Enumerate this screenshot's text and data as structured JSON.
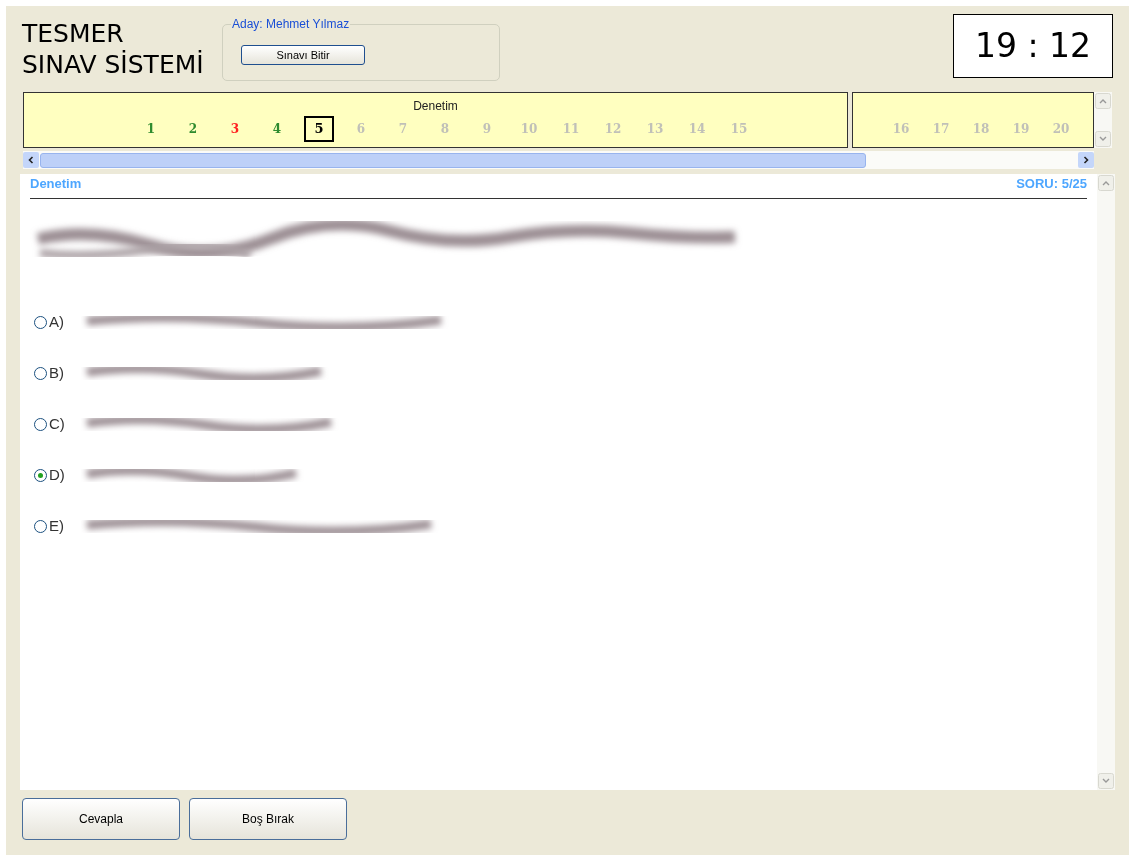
{
  "app_title": [
    "TESMER",
    "SINAV SİSTEMİ"
  ],
  "candidate": {
    "label": "Aday: Mehmet Yılmaz",
    "finish_button": "Sınavı Bitir"
  },
  "timer": "19 : 12",
  "question_nav": [
    {
      "title": "Denetim",
      "questions": [
        {
          "number": "1",
          "color": "#2e8b2e",
          "selected": false
        },
        {
          "number": "2",
          "color": "#2e8b2e",
          "selected": false
        },
        {
          "number": "3",
          "color": "#ff2020",
          "selected": false
        },
        {
          "number": "4",
          "color": "#2e8b2e",
          "selected": false
        },
        {
          "number": "5",
          "color": "#000000",
          "selected": true
        },
        {
          "number": "6",
          "color": "#c0c0b8",
          "selected": false
        },
        {
          "number": "7",
          "color": "#c0c0b8",
          "selected": false
        },
        {
          "number": "8",
          "color": "#c0c0b8",
          "selected": false
        },
        {
          "number": "9",
          "color": "#c0c0b8",
          "selected": false
        },
        {
          "number": "10",
          "color": "#c0c0b8",
          "selected": false
        },
        {
          "number": "11",
          "color": "#c0c0b8",
          "selected": false
        },
        {
          "number": "12",
          "color": "#c0c0b8",
          "selected": false
        },
        {
          "number": "13",
          "color": "#c0c0b8",
          "selected": false
        },
        {
          "number": "14",
          "color": "#c0c0b8",
          "selected": false
        },
        {
          "number": "15",
          "color": "#c0c0b8",
          "selected": false
        }
      ]
    },
    {
      "questions": [
        {
          "number": "16",
          "color": "#c0c0b8",
          "selected": false
        },
        {
          "number": "17",
          "color": "#c0c0b8",
          "selected": false
        },
        {
          "number": "18",
          "color": "#c0c0b8",
          "selected": false
        },
        {
          "number": "19",
          "color": "#c0c0b8",
          "selected": false
        },
        {
          "number": "20",
          "color": "#c0c0b8",
          "selected": false
        }
      ]
    }
  ],
  "question": {
    "section": "Denetim",
    "counter": "SORU: 5/25",
    "options": [
      {
        "label": "A)",
        "selected": false
      },
      {
        "label": "B)",
        "selected": false
      },
      {
        "label": "C)",
        "selected": false
      },
      {
        "label": "D)",
        "selected": true
      },
      {
        "label": "E)",
        "selected": false
      }
    ]
  },
  "buttons": [
    "Cevapla",
    "Boş Bırak"
  ]
}
